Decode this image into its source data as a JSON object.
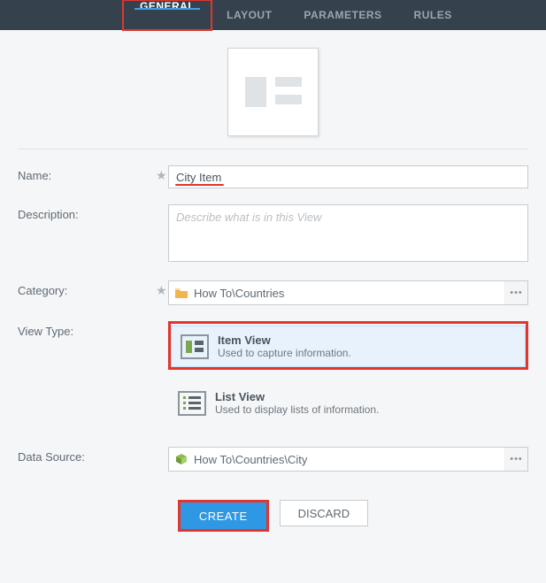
{
  "tabs": {
    "general": "GENERAL",
    "layout": "LAYOUT",
    "parameters": "PARAMETERS",
    "rules": "RULES"
  },
  "labels": {
    "name": "Name:",
    "description": "Description:",
    "category": "Category:",
    "viewType": "View Type:",
    "dataSource": "Data Source:"
  },
  "fields": {
    "name_value": "City Item",
    "description_value": "",
    "description_placeholder": "Describe what is in this View",
    "category_value": "How To\\Countries",
    "dataSource_value": "How To\\Countries\\City"
  },
  "viewTypes": {
    "item": {
      "title": "Item View",
      "desc": "Used to capture information."
    },
    "list": {
      "title": "List View",
      "desc": "Used to display lists of information."
    }
  },
  "buttons": {
    "create": "CREATE",
    "discard": "DISCARD"
  },
  "glyphs": {
    "required": "★",
    "ellipsis": "•••"
  }
}
